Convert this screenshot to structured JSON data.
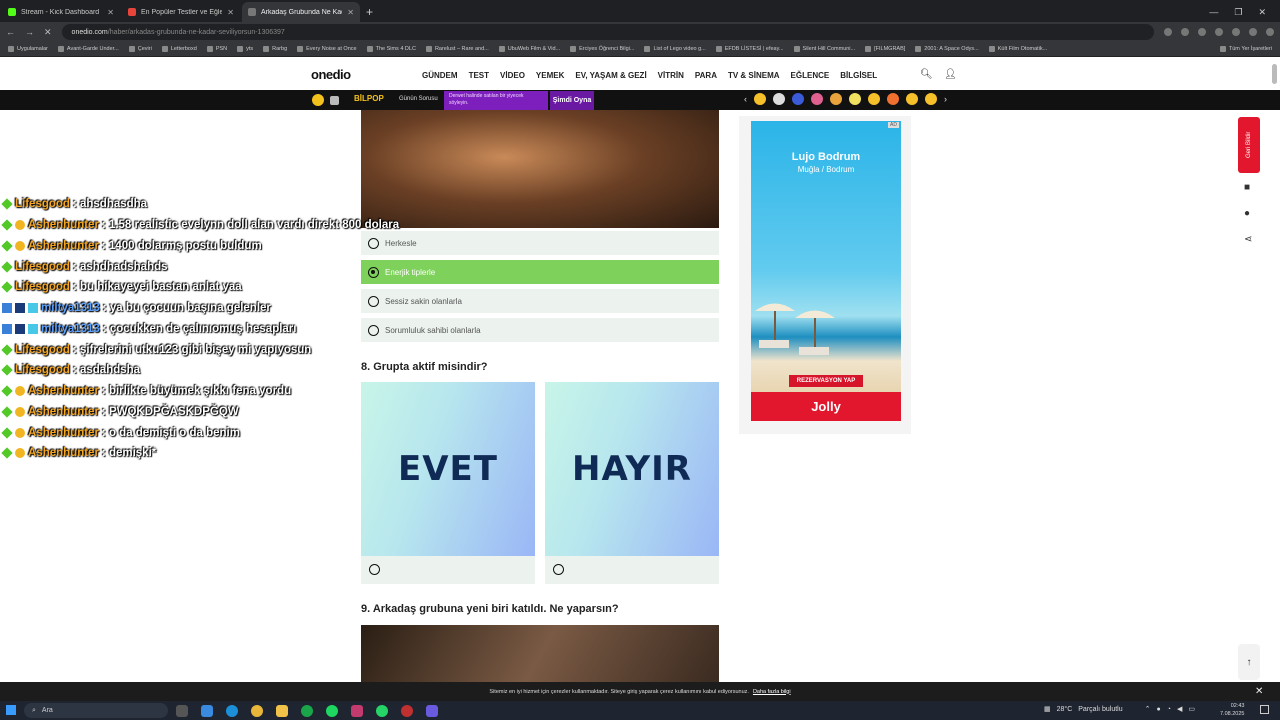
{
  "browser": {
    "tabs": [
      {
        "title": "Stream - Kick Dashboard",
        "active": false
      },
      {
        "title": "En Popüler Testler ve Eğlenceli",
        "active": false
      },
      {
        "title": "Arkadaş Grubunda Ne Kadar S...",
        "active": true
      }
    ],
    "new_tab_label": "+",
    "url_host": "onedio.com",
    "url_path": "/haber/arkadas-grubunda-ne-kadar-seviliyorsun-1306397",
    "bookmarks": [
      "Uygulamalar",
      "Avant-Garde Under...",
      "Çeviri",
      "Letterboxd",
      "PSN",
      "yts",
      "Rarbg",
      "Every Noise at Once",
      "The Sims 4 DLC",
      "Rarelust – Rare and...",
      "UbuWeb Film & Vid...",
      "Erciyes Öğrenci Bilgi...",
      "List of Lego video g...",
      "EFDB LİSTESİ | efeay...",
      "Silent Hill Communi...",
      "[FILMGRAB]",
      "2001: A Space Odys...",
      "Kült Film Otomatik..."
    ],
    "bookmarks_other": "Tüm Yer İşaretleri"
  },
  "site": {
    "logo": "onedio",
    "menu": [
      "GÜNDEM",
      "TEST",
      "VİDEO",
      "YEMEK",
      "EV, YAŞAM & GEZİ",
      "VİTRİN",
      "PARA",
      "TV & SİNEMA",
      "EĞLENCE",
      "BİLGİSEL"
    ]
  },
  "strip": {
    "bilpop": "BİLPOP",
    "gunun": "Günün Sorusu",
    "promo": "Derwet halinde satılan bir yiyecek söyleyin.",
    "simdi": "Şimdi Oyna"
  },
  "quiz": {
    "q7_options": [
      {
        "label": "Herkesle",
        "selected": false
      },
      {
        "label": "Enerjik tiplerle",
        "selected": true
      },
      {
        "label": "Sessiz sakin olanlarla",
        "selected": false
      },
      {
        "label": "Sorumluluk sahibi olanlarla",
        "selected": false
      }
    ],
    "q8_title": "8. Grupta aktif misindir?",
    "q8_cards": [
      "EVET",
      "HAYIR"
    ],
    "q9_title": "9. Arkadaş grubuna yeni biri katıldı. Ne yaparsın?"
  },
  "chat": [
    {
      "user": "Lifesgood",
      "text": ": ahsdhasdha",
      "color": "#f5a623"
    },
    {
      "user": "Ashenhunter",
      "text": ": 1.58 realistic evelynn doll alan vardı direkt 800 dolara",
      "color": "#f5a623"
    },
    {
      "user": "Ashenhunter",
      "text": ": 1400 dolarmş postu buldum",
      "color": "#f5a623"
    },
    {
      "user": "Lifesgood",
      "text": ": ashdhadshahds",
      "color": "#f5a623"
    },
    {
      "user": "Lifesgood",
      "text": ": bu hikayeyei bastan anlat yaa",
      "color": "#f5a623"
    },
    {
      "user": "miltya1313",
      "text": ": ya bu çocuun başına gelenler",
      "color": "#5aa0ff"
    },
    {
      "user": "miltya1313",
      "text": ": çocukken de çalınıomuş hesapları",
      "color": "#5aa0ff"
    },
    {
      "user": "Lifesgood",
      "text": ": şifrelerini utku123 gibi bişey mi yapıyosun",
      "color": "#f5a623"
    },
    {
      "user": "Lifesgood",
      "text": ": asdahdsha",
      "color": "#f5a623"
    },
    {
      "user": "Ashenhunter",
      "text": ": birlikte büyümek şıkkı fena yordu",
      "color": "#f5a623"
    },
    {
      "user": "Ashenhunter",
      "text": ": PWQKDPĞASKDPĞQW",
      "color": "#f5a623"
    },
    {
      "user": "Ashenhunter",
      "text": ": o da demişti o da benim",
      "color": "#f5a623"
    },
    {
      "user": "Ashenhunter",
      "text": ": demişki*",
      "color": "#f5a623"
    }
  ],
  "ad": {
    "title": "Lujo Bodrum",
    "subtitle": "Muğla / Bodrum",
    "cta": "REZERVASYON YAP",
    "brand": "Jolly",
    "tag": "AD"
  },
  "side": {
    "feedback": "Geri Bildir"
  },
  "cookie": {
    "text": "Sitemiz en iyi hizmet için çerezler kullanmaktadır. Siteye giriş yaparak çerez kullanımını kabul ediyorsunuz.",
    "link": "Daha fazla bilgi"
  },
  "taskbar": {
    "search": "Ara",
    "weather": "28°C",
    "weather_desc": "Parçalı bulutlu",
    "time": "02:43",
    "date": "7.08.2025"
  }
}
